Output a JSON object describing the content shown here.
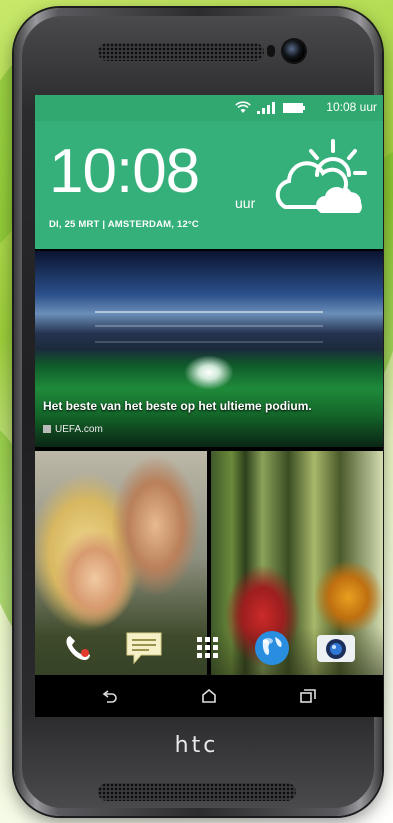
{
  "status_bar": {
    "time": "10:08 uur"
  },
  "clock_widget": {
    "time": "10:08",
    "suffix": "uur",
    "date_line": "DI, 25 MRT  |  AMSTERDAM, 12°C",
    "weather_icon": "partly-cloudy-icon"
  },
  "news_card": {
    "headline": "Het beste van het beste op het ultieme podium.",
    "source": "UEFA.com"
  },
  "dock": {
    "apps": [
      "phone-icon",
      "messages-icon",
      "apps-grid-icon",
      "browser-globe-icon",
      "camera-icon"
    ]
  },
  "nav": {
    "buttons": [
      "back-icon",
      "home-icon",
      "recent-apps-icon"
    ]
  },
  "device": {
    "brand": "htc"
  },
  "colors": {
    "accent": "#36b07a",
    "status_bar": "#30a870"
  }
}
